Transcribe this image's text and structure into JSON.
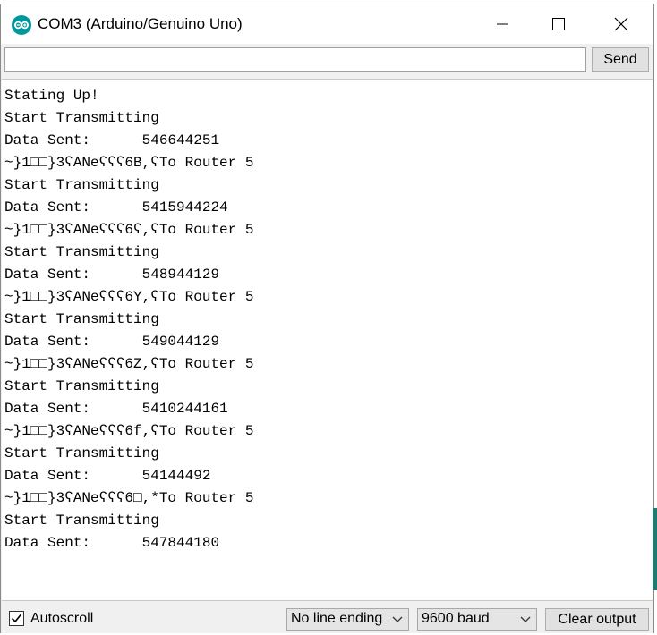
{
  "window": {
    "title": "COM3 (Arduino/Genuino Uno)",
    "app_icon": "arduino-icon",
    "controls": [
      "minimize-icon",
      "maximize-icon",
      "close-icon"
    ]
  },
  "input": {
    "value": "",
    "send_label": "Send"
  },
  "output": {
    "lines": [
      "Stating Up!",
      "Start Transmitting",
      "Data Sent:      546644251",
      "~}1□□}3ʕANeʕʕʕ6B,ʕTo Router 5",
      "Start Transmitting",
      "Data Sent:      5415944224",
      "~}1□□}3ʕANeʕʕʕ6ʕ,ʕTo Router 5",
      "Start Transmitting",
      "Data Sent:      548944129",
      "~}1□□}3ʕANeʕʕʕ6Y,ʕTo Router 5",
      "Start Transmitting",
      "Data Sent:      549044129",
      "~}1□□}3ʕANeʕʕʕ6Z,ʕTo Router 5",
      "Start Transmitting",
      "Data Sent:      5410244161",
      "~}1□□}3ʕANeʕʕʕ6f,ʕTo Router 5",
      "Start Transmitting",
      "Data Sent:      54144492",
      "~}1□□}3ʕANeʕʕʕ6□,*To Router 5",
      "Start Transmitting",
      "Data Sent:      547844180"
    ]
  },
  "footer": {
    "autoscroll_label": "Autoscroll",
    "autoscroll_checked": true,
    "line_ending": "No line ending",
    "baud": "9600 baud",
    "clear_label": "Clear output"
  },
  "colors": {
    "arduino_teal": "#00979c",
    "window_bg": "#f0f0f0",
    "text": "#000000"
  }
}
